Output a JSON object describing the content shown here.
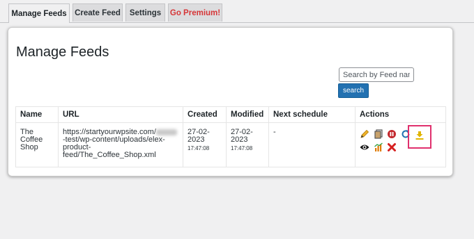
{
  "tabs": [
    {
      "label": "Manage Feeds",
      "active": true
    },
    {
      "label": "Create Feed",
      "active": false
    },
    {
      "label": "Settings",
      "active": false
    },
    {
      "label": "Go Premium!",
      "active": false
    }
  ],
  "page": {
    "title": "Manage Feeds"
  },
  "search": {
    "placeholder": "Search by Feed name",
    "button_label": "search"
  },
  "table": {
    "headers": [
      "Name",
      "URL",
      "Created",
      "Modified",
      "Next schedule",
      "Actions"
    ],
    "rows": [
      {
        "name": "The Coffee Shop",
        "url_prefix": "https://startyourwpsite.com/",
        "url_rest": "-test/wp-content/uploads/elex-product-feed/The_Coffee_Shop.xml",
        "created_date": "27-02-2023",
        "created_time": "17:47:08",
        "modified_date": "27-02-2023",
        "modified_time": "17:47:08",
        "next_schedule": "-"
      }
    ]
  },
  "action_icons": [
    "edit-icon",
    "copy-icon",
    "pause-icon",
    "refresh-icon",
    "download-icon",
    "view-icon",
    "analytics-icon",
    "delete-icon"
  ],
  "colors": {
    "primary": "#2271b1",
    "premium": "#d63638",
    "highlight": "#e0306d"
  }
}
